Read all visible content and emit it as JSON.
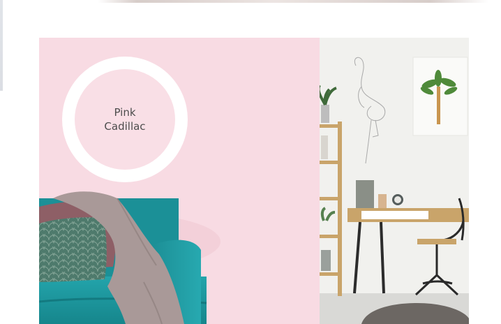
{
  "swatch": {
    "label": "Pink\nCadillac"
  },
  "colors": {
    "panel_pink": "#f8dbe3",
    "swatch_pink": "#f9dfe6",
    "sofa_teal": "#1f9aa1",
    "throw_gray": "#a99998",
    "pillow_mauve": "#8e5f66",
    "pillow_green": "#4e7a6c",
    "desk_wood": "#c9a46a"
  },
  "icons": {
    "flamingo_art": "flamingo-line-drawing-icon",
    "palm_art": "palm-tree-print-icon"
  }
}
